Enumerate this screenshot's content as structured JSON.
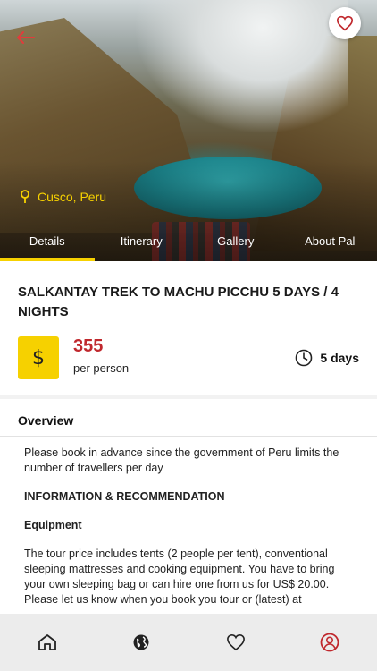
{
  "header": {
    "location": "Cusco, Peru"
  },
  "tabs": [
    {
      "label": "Details",
      "active": true
    },
    {
      "label": "Itinerary",
      "active": false
    },
    {
      "label": "Gallery",
      "active": false
    },
    {
      "label": "About Pal",
      "active": false
    }
  ],
  "tour": {
    "title": "SALKANTAY TREK TO MACHU PICCHU 5 DAYS / 4 NIGHTS",
    "currency_symbol": "$",
    "price": "355",
    "price_unit": "per person",
    "duration": "5 days"
  },
  "overview": {
    "heading": "Overview",
    "paragraphs": [
      "Please book in advance since the government of Peru limits the number of travellers per day",
      "INFORMATION & RECOMMENDATION",
      "Equipment",
      "The tour price includes tents (2 people per tent), conventional sleeping mattresses and cooking equipment. You have to bring your own sleeping bag or can hire one from us for US$ 20.00. Please let us know when you book you tour or (latest) at"
    ]
  },
  "colors": {
    "accent": "#f6d100",
    "price": "#c0282d",
    "back_arrow": "#e23b3b",
    "profile_active": "#c0282d"
  },
  "icons": {
    "back": "arrow-left-icon",
    "favorite": "heart-icon",
    "location": "location-pin-icon",
    "duration": "clock-icon",
    "nav": [
      "home-icon",
      "globe-icon",
      "heart-icon",
      "profile-icon"
    ]
  }
}
